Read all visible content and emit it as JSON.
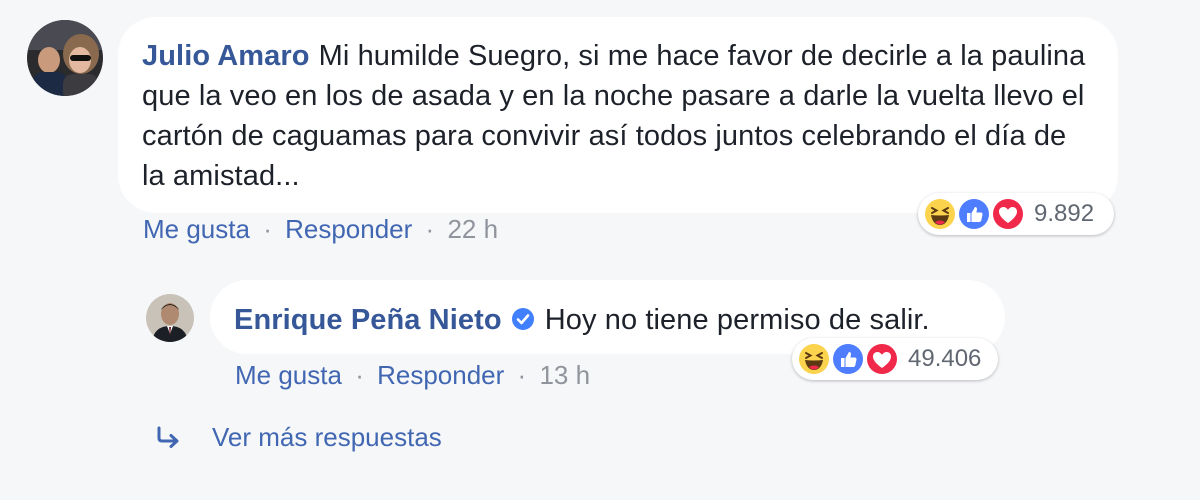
{
  "comment": {
    "author": "Julio Amaro",
    "text": "Mi humilde Suegro, si me hace favor de decirle a la paulina que la veo en los de asada y en la noche pasare a darle la vuelta llevo el cartón de caguamas para convivir así todos juntos celebrando el día de la amistad...",
    "actions": {
      "like_label": "Me gusta",
      "reply_label": "Responder",
      "separator": "·",
      "time": "22 h"
    },
    "reactions": {
      "icons": [
        "haha-icon",
        "like-icon",
        "love-icon"
      ],
      "count": "9.892"
    }
  },
  "reply": {
    "author": "Enrique Peña Nieto",
    "verified": true,
    "text": "Hoy no tiene permiso de salir.",
    "actions": {
      "like_label": "Me gusta",
      "reply_label": "Responder",
      "separator": "·",
      "time": "13 h"
    },
    "reactions": {
      "icons": [
        "haha-icon",
        "like-icon",
        "love-icon"
      ],
      "count": "49.406"
    }
  },
  "more_replies_label": "Ver más respuestas",
  "colors": {
    "background": "#f6f7f9",
    "bubble": "#ffffff",
    "author_link": "#365899",
    "action_link": "#4267b2",
    "muted": "#90949c",
    "like_blue": "#4f7dff",
    "love_red": "#f0284a",
    "haha_yellow": "#fcd34d",
    "verified_blue": "#4080ff"
  }
}
